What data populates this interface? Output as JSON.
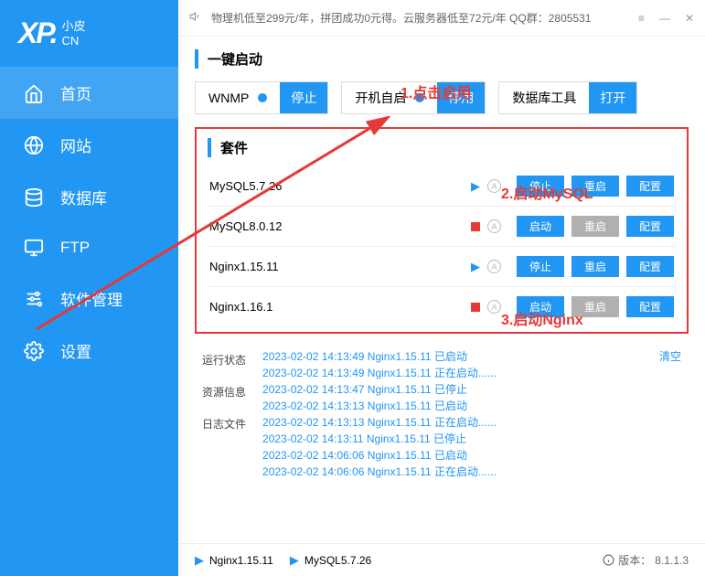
{
  "logo": {
    "xp": "XP.",
    "small": "小皮",
    "cn": "CN"
  },
  "topbar": {
    "notice": "物理机低至299元/年，拼团成功0元得。云服务器低至72元/年   QQ群：2805531"
  },
  "nav": [
    {
      "label": "首页",
      "icon": "home"
    },
    {
      "label": "网站",
      "icon": "globe"
    },
    {
      "label": "数据库",
      "icon": "db"
    },
    {
      "label": "FTP",
      "icon": "monitor"
    },
    {
      "label": "软件管理",
      "icon": "sliders"
    },
    {
      "label": "设置",
      "icon": "gear"
    }
  ],
  "quick": {
    "title": "一键启动",
    "boxes": [
      {
        "label": "WNMP",
        "dot": true,
        "btn": "停止"
      },
      {
        "label": "开机自启",
        "dot": true,
        "btn": "停用"
      },
      {
        "label": "数据库工具",
        "dot": false,
        "btn": "打开"
      }
    ]
  },
  "suite": {
    "title": "套件",
    "rows": [
      {
        "name": "MySQL5.7.26",
        "running": true,
        "actions": [
          "停止",
          "重启",
          "配置"
        ],
        "gray_idx": -1
      },
      {
        "name": "MySQL8.0.12",
        "running": false,
        "actions": [
          "启动",
          "重启",
          "配置"
        ],
        "gray_idx": 1
      },
      {
        "name": "Nginx1.15.11",
        "running": true,
        "actions": [
          "停止",
          "重启",
          "配置"
        ],
        "gray_idx": -1
      },
      {
        "name": "Nginx1.16.1",
        "running": false,
        "actions": [
          "启动",
          "重启",
          "配置"
        ],
        "gray_idx": 1
      }
    ]
  },
  "info": {
    "labels": [
      "运行状态",
      "资源信息",
      "日志文件"
    ],
    "clear": "清空",
    "logs": [
      "2023-02-02 14:13:49 Nginx1.15.11 已启动",
      "2023-02-02 14:13:49 Nginx1.15.11 正在启动......",
      "2023-02-02 14:13:47 Nginx1.15.11 已停止",
      "2023-02-02 14:13:13 Nginx1.15.11 已启动",
      "2023-02-02 14:13:13 Nginx1.15.11 正在启动......",
      "2023-02-02 14:13:11 Nginx1.15.11 已停止",
      "2023-02-02 14:06:06 Nginx1.15.11 已启动",
      "2023-02-02 14:06:06 Nginx1.15.11 正在启动......"
    ]
  },
  "footer": {
    "items": [
      "Nginx1.15.11",
      "MySQL5.7.26"
    ],
    "version_label": "版本：",
    "version": "8.1.1.3"
  },
  "annotations": {
    "a1": "1.点击启用",
    "a2": "2.启动MySQL",
    "a3": "3.启动Nginx"
  }
}
